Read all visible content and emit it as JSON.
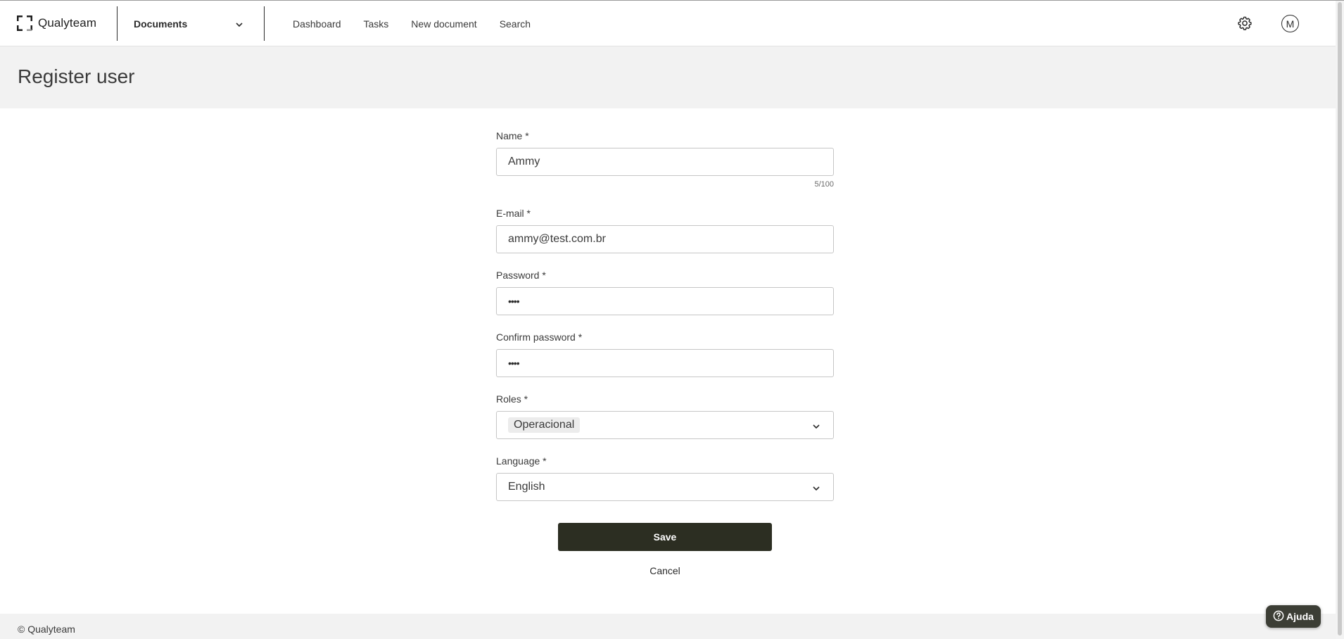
{
  "header": {
    "brand": "Qualyteam",
    "module": "Documents",
    "nav": [
      "Dashboard",
      "Tasks",
      "New document",
      "Search"
    ],
    "avatar_initial": "M",
    "icons": {
      "logo": "qualyteam-logo-icon",
      "module_chevron": "chevron-down-icon",
      "settings": "gear-icon"
    }
  },
  "page": {
    "title": "Register user"
  },
  "form": {
    "name": {
      "label": "Name *",
      "value": "Ammy",
      "counter": "5/100"
    },
    "email": {
      "label": "E-mail *",
      "value": "ammy@test.com.br"
    },
    "password": {
      "label": "Password *",
      "masked_value": "••••"
    },
    "confirm_password": {
      "label": "Confirm password *",
      "masked_value": "••••"
    },
    "roles": {
      "label": "Roles *",
      "selected": "Operacional"
    },
    "language": {
      "label": "Language *",
      "selected": "English"
    },
    "save_label": "Save",
    "cancel_label": "Cancel"
  },
  "footer": {
    "copyright": "© Qualyteam"
  },
  "help": {
    "label": "Ajuda",
    "icon": "question-circle-icon"
  },
  "colors": {
    "primary_button": "#2c2e22",
    "band_background": "#f2f2f2",
    "help_button": "#3c3e35"
  }
}
